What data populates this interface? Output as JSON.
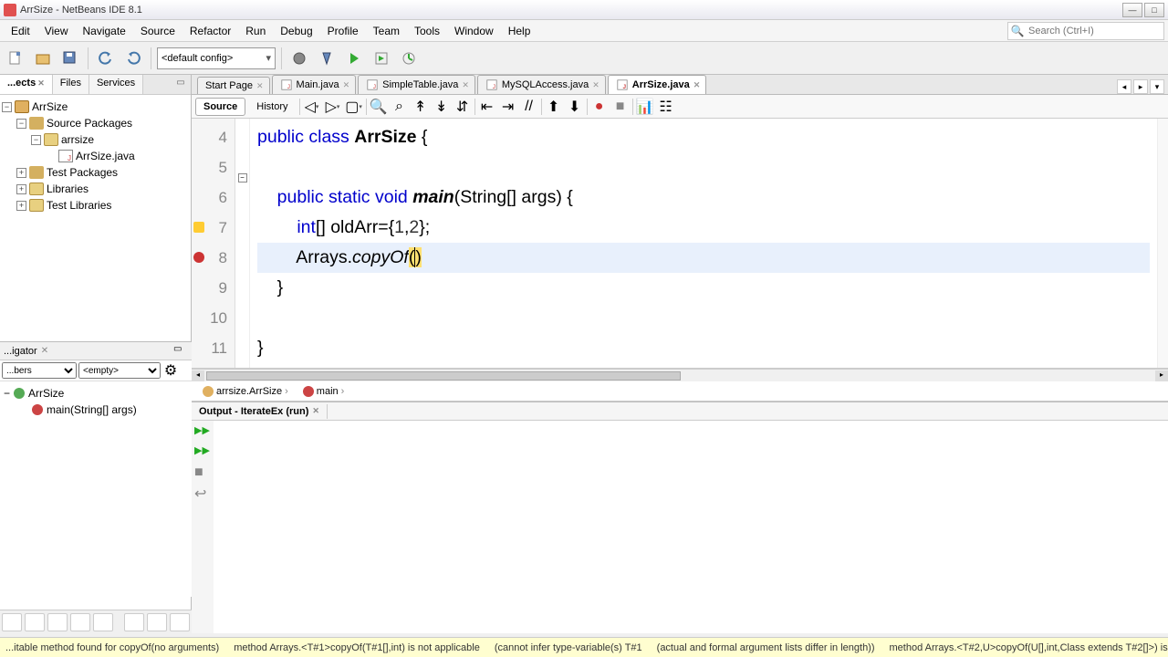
{
  "titlebar": {
    "title": "ArrSize - NetBeans IDE 8.1"
  },
  "menu": [
    "Edit",
    "View",
    "Navigate",
    "Source",
    "Refactor",
    "Run",
    "Debug",
    "Profile",
    "Team",
    "Tools",
    "Window",
    "Help"
  ],
  "search_placeholder": "Search (Ctrl+I)",
  "config_combo": "<default config>",
  "left_tabs": [
    "...ects",
    "Files",
    "Services"
  ],
  "active_left_tab": 0,
  "project_tree": {
    "root": "ArrSize",
    "children": [
      {
        "label": "Source Packages",
        "icon": "pkg",
        "children": [
          {
            "label": "arrsize",
            "icon": "folder",
            "children": [
              {
                "label": "ArrSize.java",
                "icon": "java"
              }
            ]
          }
        ]
      },
      {
        "label": "Test Packages",
        "icon": "pkg"
      },
      {
        "label": "Libraries",
        "icon": "folder"
      },
      {
        "label": "Test Libraries",
        "icon": "folder"
      }
    ]
  },
  "navigator": {
    "title": "...igator",
    "combo1": "...bers",
    "combo2": "<empty>",
    "class": "ArrSize",
    "method": "main(String[] args)"
  },
  "editor_tabs": [
    {
      "label": "Start Page",
      "is_start": true
    },
    {
      "label": "Main.java"
    },
    {
      "label": "SimpleTable.java"
    },
    {
      "label": "MySQLAccess.java"
    },
    {
      "label": "ArrSize.java",
      "active": true
    }
  ],
  "subtabs": {
    "source": "Source",
    "history": "History"
  },
  "code_lines": {
    "start_num": 4,
    "lines": [
      "public class ArrSize {",
      "",
      "    public static void main(String[] args) {",
      "        int[] oldArr={1,2};",
      "        Arrays.copyOf()",
      "    }",
      "",
      "}",
      ""
    ]
  },
  "crumbs": {
    "a": "arrsize.ArrSize",
    "b": "main"
  },
  "output_tab": "Output - IterateEx (run)",
  "status": [
    "...itable method found for copyOf(no arguments)",
    "method Arrays.<T#1>copyOf(T#1[],int) is not applicable",
    "(cannot infer type-variable(s) T#1",
    "(actual and formal argument lists differ in length))",
    "method Arrays.<T#2,U>copyOf(U[],int,Class    extends T#2[]>) is"
  ]
}
